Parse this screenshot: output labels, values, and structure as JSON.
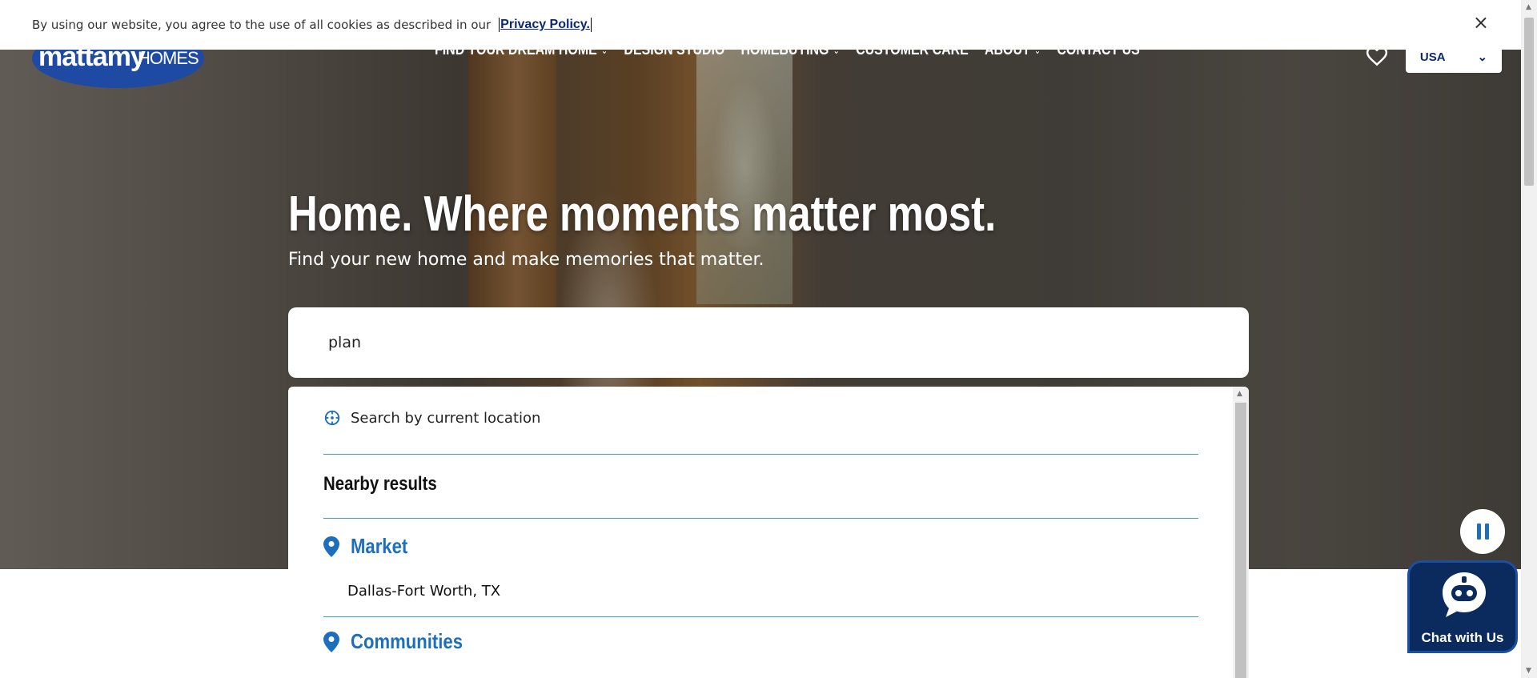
{
  "cookie": {
    "text": "By using our website, you agree to the use of all cookies as described in our",
    "link": "Privacy Policy.",
    "close_icon": "×"
  },
  "header": {
    "logo_main": "mattamy",
    "logo_sub": "HOMES",
    "nav": [
      {
        "label": "FIND YOUR DREAM HOME",
        "has_dropdown": true
      },
      {
        "label": "DESIGN STUDIO",
        "has_dropdown": false
      },
      {
        "label": "HOMEBUYING",
        "has_dropdown": true
      },
      {
        "label": "CUSTOMER CARE",
        "has_dropdown": false
      },
      {
        "label": "ABOUT",
        "has_dropdown": true
      },
      {
        "label": "CONTACT US",
        "has_dropdown": false
      }
    ],
    "region": "USA",
    "chevron": "⌄",
    "favorites_icon": "heart-icon"
  },
  "hero": {
    "title": "Home. Where moments matter most.",
    "subtitle": "Find your new home and make memories that matter."
  },
  "search": {
    "value": "plan",
    "current_location": "Search by current location",
    "nearby_heading": "Nearby results",
    "groups": [
      {
        "label": "Market",
        "items": [
          "Dallas-Fort Worth, TX"
        ]
      },
      {
        "label": "Communities",
        "items": []
      }
    ]
  },
  "chat": {
    "label": "Chat with Us"
  },
  "colors": {
    "brand_blue": "#1d6fbe",
    "navy": "#0b2a5e",
    "divider": "#3aa6c2"
  }
}
